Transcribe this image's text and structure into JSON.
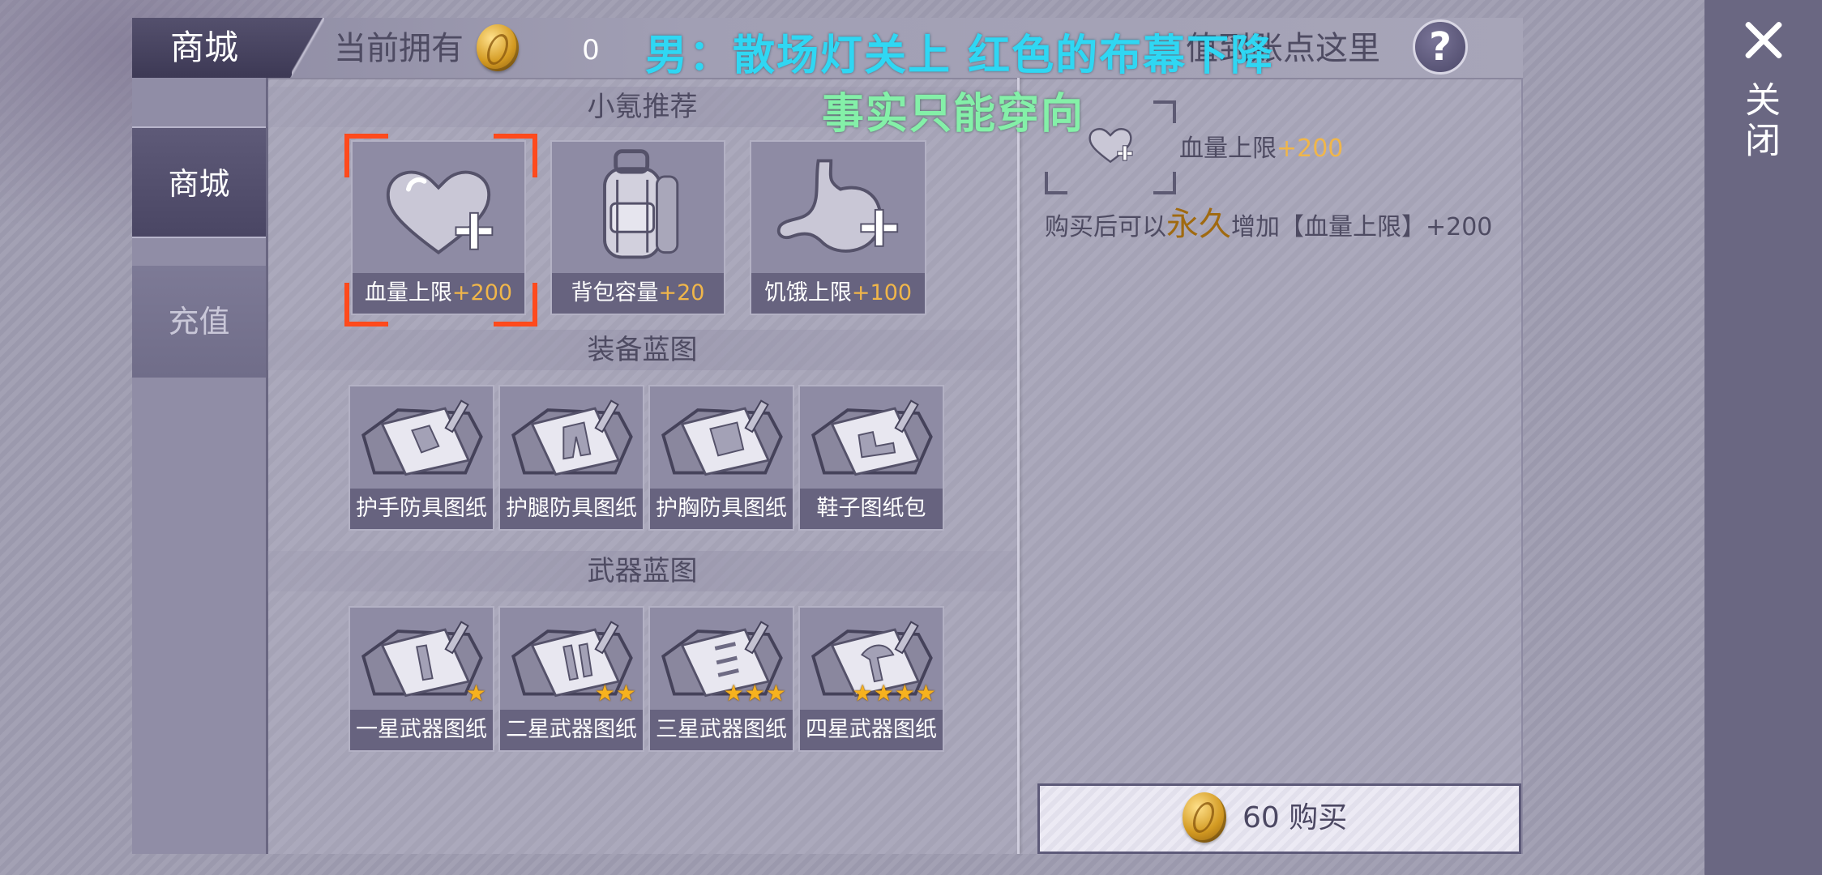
{
  "header": {
    "shop_tab": "商城",
    "owned_label": "当前拥有",
    "coin_amount": "0",
    "recharge_label": "值到账点这里",
    "help_label": "?"
  },
  "subtitles": {
    "line1": "男：散场灯关上 红色的布幕下降",
    "line2": "事实只能穿向"
  },
  "sidebar": {
    "items": [
      {
        "label": "商城",
        "active": true
      },
      {
        "label": "充值",
        "active": false
      }
    ]
  },
  "sections": {
    "recommend": {
      "title": "小氪推荐",
      "items": [
        {
          "name": "血量上限",
          "bonus": "+200",
          "icon": "heart-plus-icon",
          "selected": true
        },
        {
          "name": "背包容量",
          "bonus": "+20",
          "icon": "backpack-icon",
          "selected": false
        },
        {
          "name": "饥饿上限",
          "bonus": "+100",
          "icon": "stomach-plus-icon",
          "selected": false
        }
      ]
    },
    "gear": {
      "title": "装备蓝图",
      "items": [
        {
          "name": "护手防具图纸",
          "icon": "blueprint-gloves-icon"
        },
        {
          "name": "护腿防具图纸",
          "icon": "blueprint-pants-icon"
        },
        {
          "name": "护胸防具图纸",
          "icon": "blueprint-chest-icon"
        },
        {
          "name": "鞋子图纸包",
          "icon": "blueprint-shoes-icon"
        }
      ]
    },
    "weapons": {
      "title": "武器蓝图",
      "items": [
        {
          "name": "一星武器图纸",
          "stars": 1,
          "icon": "blueprint-weapon-icon"
        },
        {
          "name": "二星武器图纸",
          "stars": 2,
          "icon": "blueprint-weapon-icon"
        },
        {
          "name": "三星武器图纸",
          "stars": 3,
          "icon": "blueprint-weapon-icon"
        },
        {
          "name": "四星武器图纸",
          "stars": 4,
          "icon": "blueprint-weapon-icon"
        }
      ]
    }
  },
  "detail": {
    "name": "血量上限",
    "bonus": "+200",
    "desc_prefix": "购买后可以",
    "desc_highlight": "永久",
    "desc_suffix": "增加【血量上限】+200",
    "buy_label": "60 购买"
  },
  "close_label": "关闭",
  "colors": {
    "bonus": "#f0b64a",
    "selection": "#ff4a1c",
    "subtitle1": "#2fd7f3",
    "subtitle2": "#84f0a8",
    "highlight": "#a06a10"
  }
}
